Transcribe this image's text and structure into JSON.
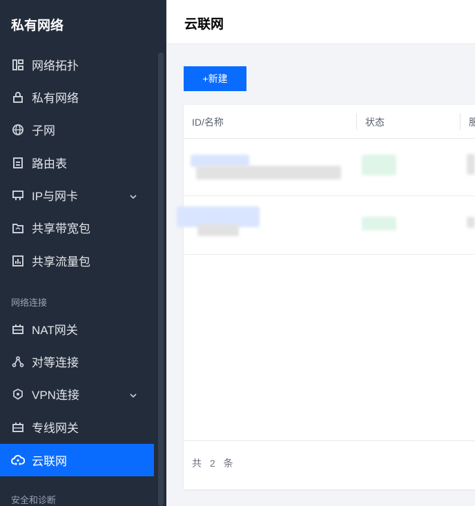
{
  "sidebar": {
    "title": "私有网络",
    "items": [
      {
        "label": "网络拓扑",
        "icon": "topology-icon"
      },
      {
        "label": "私有网络",
        "icon": "lock-icon"
      },
      {
        "label": "子网",
        "icon": "globe-icon"
      },
      {
        "label": "路由表",
        "icon": "route-table-icon"
      },
      {
        "label": "IP与网卡",
        "icon": "network-card-icon"
      },
      {
        "label": "共享带宽包",
        "icon": "bandwidth-package-icon"
      },
      {
        "label": "共享流量包",
        "icon": "traffic-package-icon"
      },
      {
        "label": "NAT网关",
        "icon": "nat-gateway-icon"
      },
      {
        "label": "对等连接",
        "icon": "peering-icon"
      },
      {
        "label": "VPN连接",
        "icon": "vpn-icon"
      },
      {
        "label": "专线网关",
        "icon": "dedicated-gateway-icon"
      },
      {
        "label": "云联网",
        "icon": "cloud-network-icon"
      }
    ],
    "sections": [
      "网络连接",
      "安全和诊断"
    ]
  },
  "main": {
    "title": "云联网",
    "new_button": "+新建",
    "table": {
      "columns": [
        "ID/名称",
        "状态",
        "服"
      ]
    },
    "footer": {
      "total": "共 2 条"
    }
  },
  "colors": {
    "accent": "#0a6cff",
    "sidebar_bg": "#232c3b"
  }
}
